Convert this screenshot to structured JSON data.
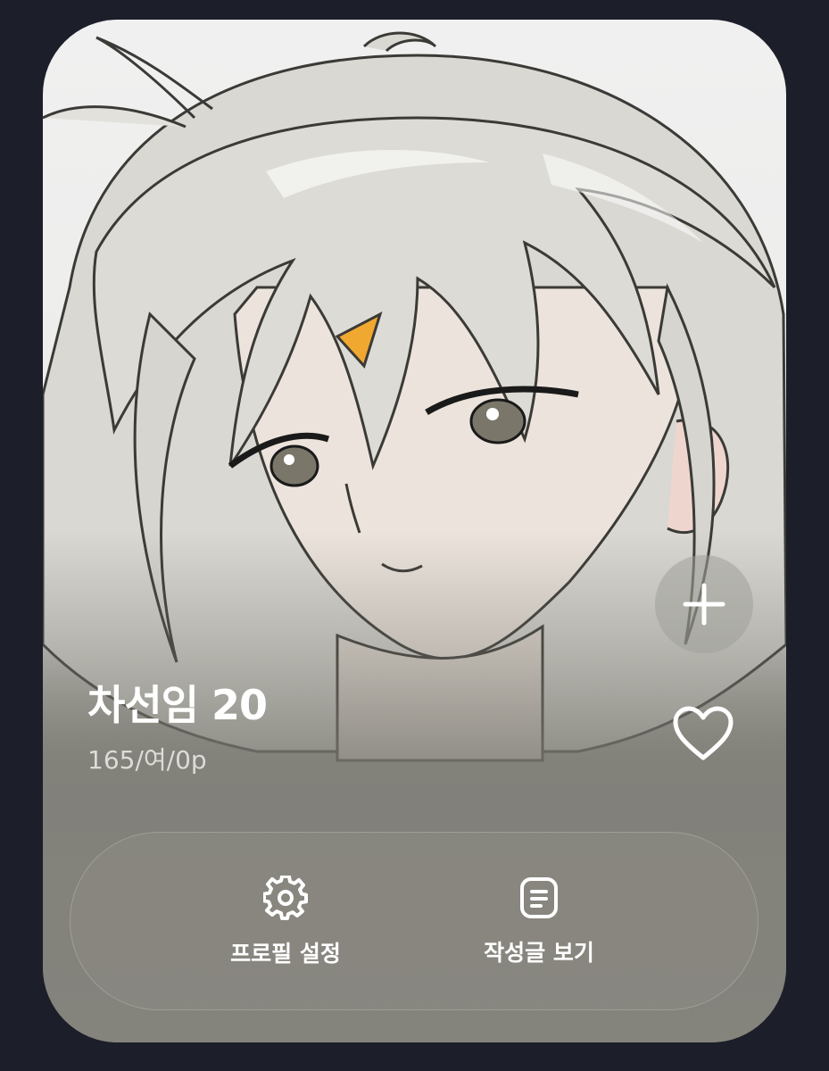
{
  "profile": {
    "name": "차선임 20",
    "meta": "165/여/0p"
  },
  "actions": {
    "add_icon": "plus-icon",
    "like_icon": "heart-icon",
    "profile_settings_label": "프로필 설정",
    "profile_settings_icon": "gear-icon",
    "view_posts_label": "작성글 보기",
    "view_posts_icon": "document-icon"
  },
  "colors": {
    "background": "#1c1f29",
    "text_primary": "#ffffff",
    "text_secondary": "#dcdcd8",
    "hairclip": "#f0a830"
  }
}
